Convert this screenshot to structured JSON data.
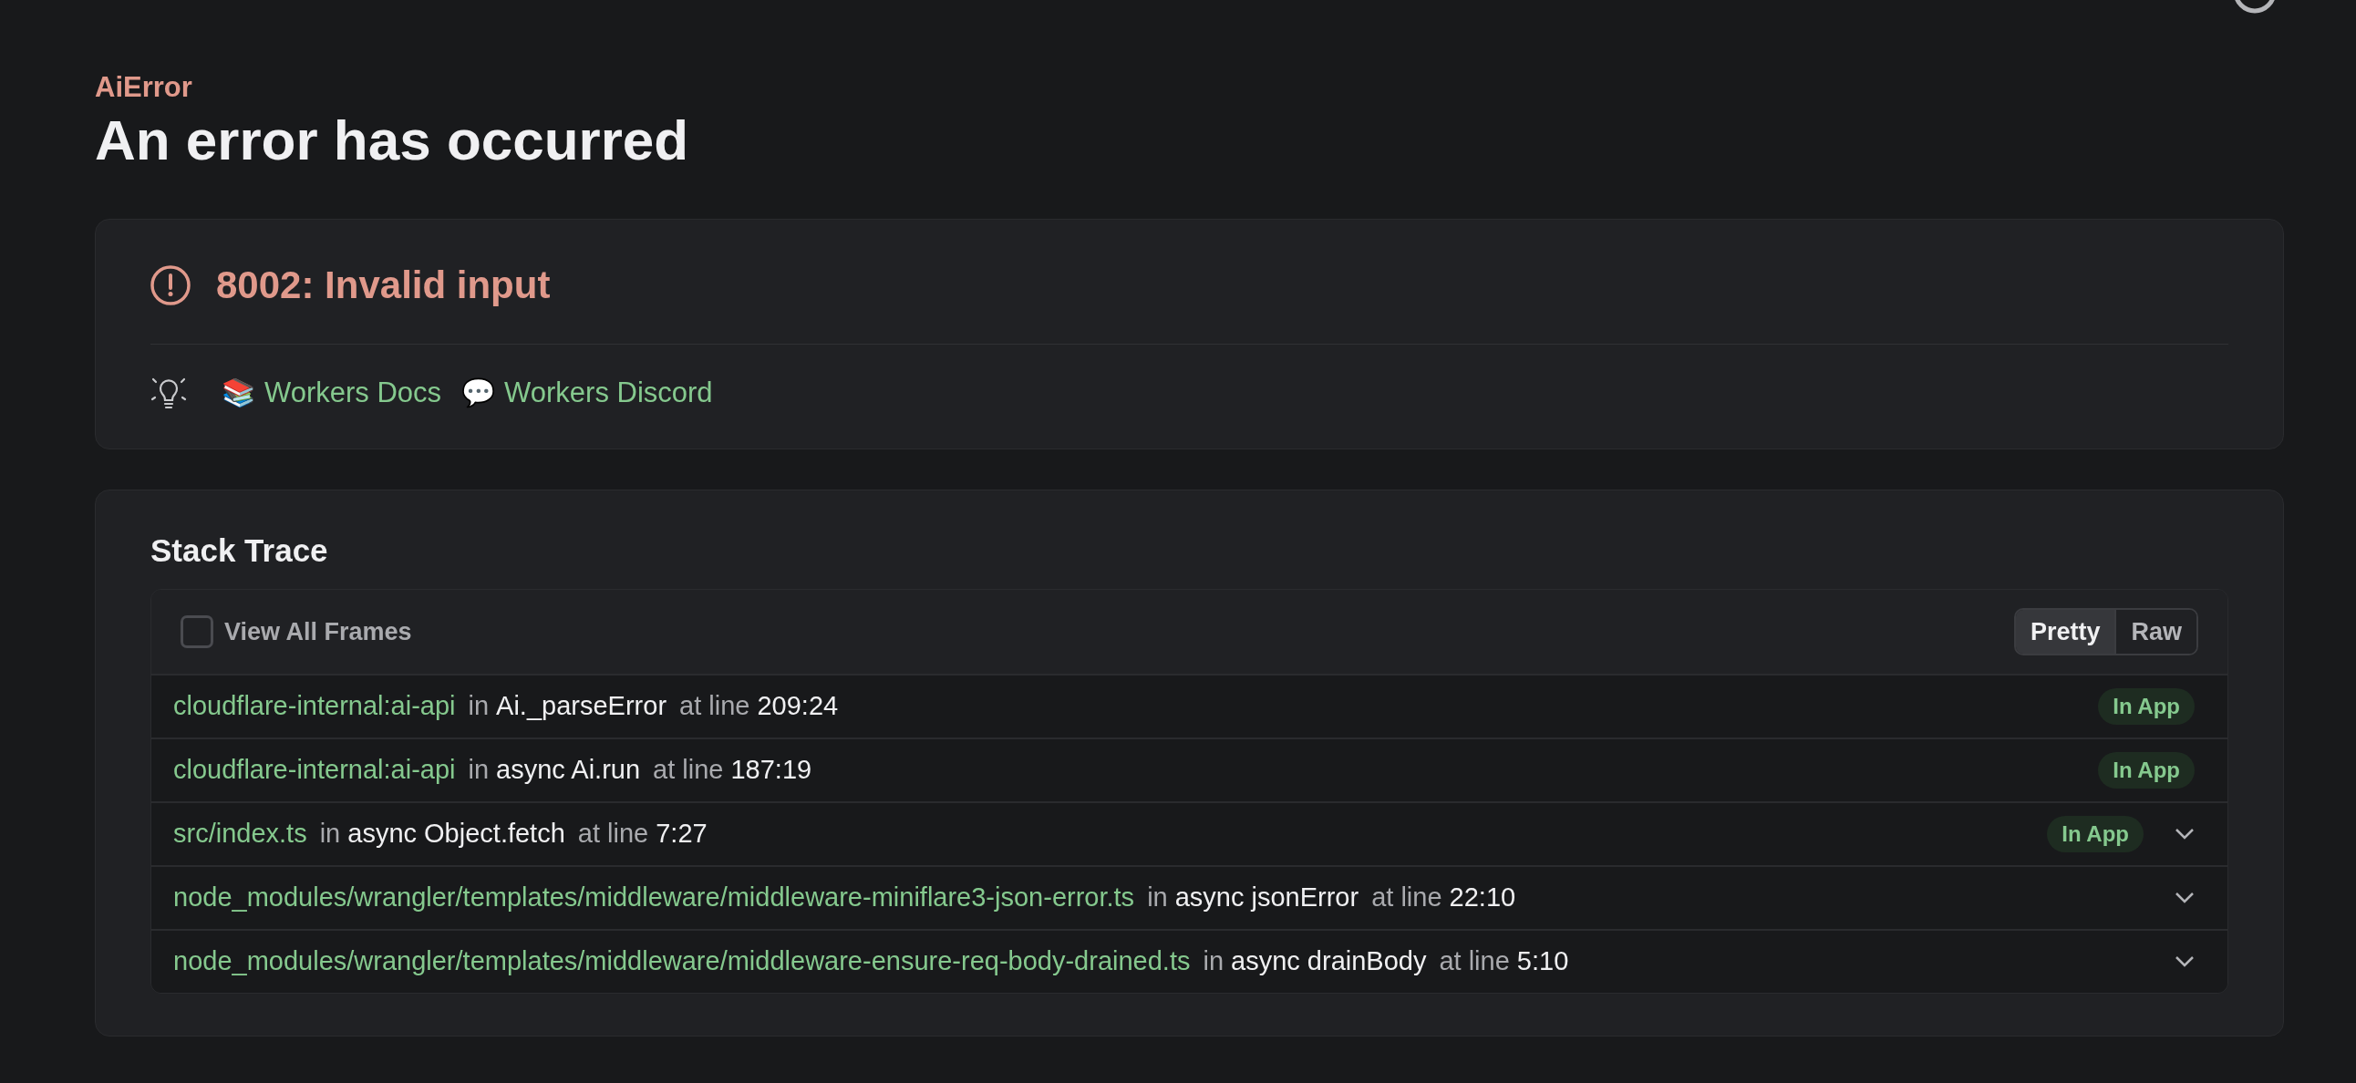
{
  "error": {
    "type": "AiError",
    "title": "An error has occurred",
    "message": "8002: Invalid input"
  },
  "links": [
    {
      "emoji": "📚",
      "label": "Workers Docs"
    },
    {
      "emoji": "💬",
      "label": "Workers Discord"
    }
  ],
  "stack_trace": {
    "title": "Stack Trace",
    "view_all_frames": {
      "label": "View All Frames",
      "checked": false
    },
    "format_tabs": [
      {
        "label": "Pretty",
        "selected": true
      },
      {
        "label": "Raw",
        "selected": false
      }
    ],
    "frames": [
      {
        "file": "cloudflare-internal:ai-api",
        "in": "in",
        "function": "Ai._parseError",
        "at": "at line",
        "location": "209:24",
        "badge": "In App",
        "expandable": false
      },
      {
        "file": "cloudflare-internal:ai-api",
        "in": "in",
        "function": "async Ai.run",
        "at": "at line",
        "location": "187:19",
        "badge": "In App",
        "expandable": false
      },
      {
        "file": "src/index.ts",
        "in": "in",
        "function": "async Object.fetch",
        "at": "at line",
        "location": "7:27",
        "badge": "In App",
        "expandable": true
      },
      {
        "file": "node_modules/wrangler/templates/middleware/middleware-miniflare3-json-error.ts",
        "in": "in",
        "function": "async jsonError",
        "at": "at line",
        "location": "22:10",
        "expandable": true
      },
      {
        "file": "node_modules/wrangler/templates/middleware/middleware-ensure-req-body-drained.ts",
        "in": "in",
        "function": "async drainBody",
        "at": "at line",
        "location": "5:10",
        "expandable": true
      }
    ]
  }
}
